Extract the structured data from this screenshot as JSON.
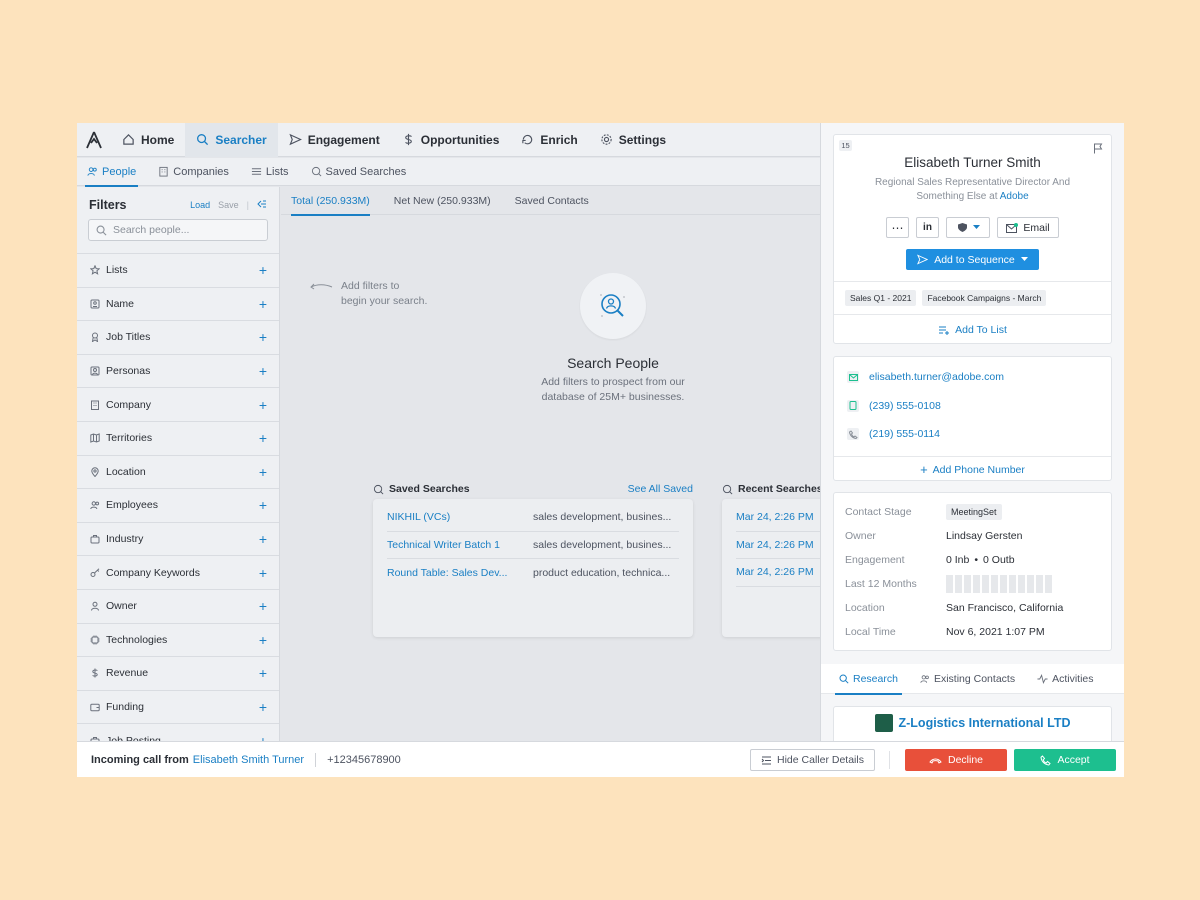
{
  "nav": {
    "items": [
      {
        "label": "Home",
        "icon": "home-icon",
        "active": false
      },
      {
        "label": "Searcher",
        "icon": "search-icon",
        "active": true
      },
      {
        "label": "Engagement",
        "icon": "send-icon",
        "active": false
      },
      {
        "label": "Opportunities",
        "icon": "dollar-icon",
        "active": false
      },
      {
        "label": "Enrich",
        "icon": "refresh-icon",
        "active": false
      },
      {
        "label": "Settings",
        "icon": "gear-icon",
        "active": false
      }
    ]
  },
  "subnav": {
    "items": [
      {
        "label": "People",
        "icon": "people-icon",
        "active": true
      },
      {
        "label": "Companies",
        "icon": "building-icon",
        "active": false
      },
      {
        "label": "Lists",
        "icon": "list-icon",
        "active": false
      },
      {
        "label": "Saved Searches",
        "icon": "saved-search-icon",
        "active": false
      }
    ]
  },
  "filters": {
    "title": "Filters",
    "load": "Load",
    "save": "Save",
    "search_placeholder": "Search people...",
    "items": [
      {
        "label": "Lists",
        "icon": "star-icon"
      },
      {
        "label": "Name",
        "icon": "id-card-icon"
      },
      {
        "label": "Job Titles",
        "icon": "badge-icon"
      },
      {
        "label": "Personas",
        "icon": "persona-icon"
      },
      {
        "label": "Company",
        "icon": "building-icon"
      },
      {
        "label": "Territories",
        "icon": "map-icon"
      },
      {
        "label": "Location",
        "icon": "pin-icon"
      },
      {
        "label": "Employees",
        "icon": "people-icon"
      },
      {
        "label": "Industry",
        "icon": "briefcase-icon"
      },
      {
        "label": "Company Keywords",
        "icon": "key-icon"
      },
      {
        "label": "Owner",
        "icon": "user-icon"
      },
      {
        "label": "Technologies",
        "icon": "chip-icon"
      },
      {
        "label": "Revenue",
        "icon": "dollar-icon"
      },
      {
        "label": "Funding",
        "icon": "wallet-icon"
      },
      {
        "label": "Job Posting",
        "icon": "briefcase-icon"
      }
    ]
  },
  "tabs": [
    {
      "label": "Total (250.933M)",
      "active": true
    },
    {
      "label": "Net New (250.933M)",
      "active": false
    },
    {
      "label": "Saved Contacts",
      "active": false
    }
  ],
  "hint": {
    "line1": "Add filters to",
    "line2": "begin your search."
  },
  "empty": {
    "title": "Search People",
    "line1": "Add filters to prospect from our",
    "line2": "database of 25M+ businesses."
  },
  "saved_searches": {
    "title": "Saved Searches",
    "see_all": "See All Saved",
    "rows": [
      {
        "name": "NIKHIL (VCs)",
        "desc": "sales development, busines..."
      },
      {
        "name": "Technical Writer Batch 1",
        "desc": "sales development, busines..."
      },
      {
        "name": "Round Table: Sales Dev...",
        "desc": "product education, technica..."
      }
    ]
  },
  "recent_searches": {
    "title": "Recent Searches",
    "rows": [
      "Mar 24, 2:26 PM",
      "Mar 24, 2:26 PM",
      "Mar 24, 2:26 PM"
    ]
  },
  "call": {
    "label": "Incoming call from",
    "name": "Elisabeth Smith Turner",
    "phone": "+12345678900",
    "hide": "Hide Caller Details",
    "decline": "Decline",
    "accept": "Accept"
  },
  "profile": {
    "badge": "15",
    "name": "Elisabeth Turner Smith",
    "title_line1": "Regional Sales Representative Director And",
    "title_line2": "Something Else at",
    "company": "Adobe",
    "email_btn": "Email",
    "sequence_btn": "Add to Sequence",
    "tags": [
      "Sales Q1 - 2021",
      "Facebook Campaigns - March"
    ],
    "add_to_list": "Add To List"
  },
  "contact": {
    "email": "elisabeth.turner@adobe.com",
    "phone1": "(239) 555-0108",
    "phone2": "(219) 555-0114",
    "add_phone": "Add Phone Number"
  },
  "details": {
    "stage_label": "Contact Stage",
    "stage": "MeetingSet",
    "owner_label": "Owner",
    "owner": "Lindsay Gersten",
    "engagement_label": "Engagement",
    "inbound": "0 Inb",
    "outbound": "0 Outb",
    "months_label": "Last 12 Months",
    "location_label": "Location",
    "location": "San Francisco, California",
    "time_label": "Local Time",
    "time": "Nov 6, 2021 1:07 PM"
  },
  "panel_tabs": [
    {
      "label": "Research",
      "active": true
    },
    {
      "label": "Existing Contacts",
      "active": false
    },
    {
      "label": "Activities",
      "active": false
    }
  ],
  "company_card": {
    "name": "Z-Logistics International LTD"
  },
  "colors": {
    "accent": "#1a7fc4",
    "decline": "#e8503a",
    "accept": "#1dbf8f",
    "sequence": "#1f8fe0",
    "background": "#fde3bd"
  }
}
